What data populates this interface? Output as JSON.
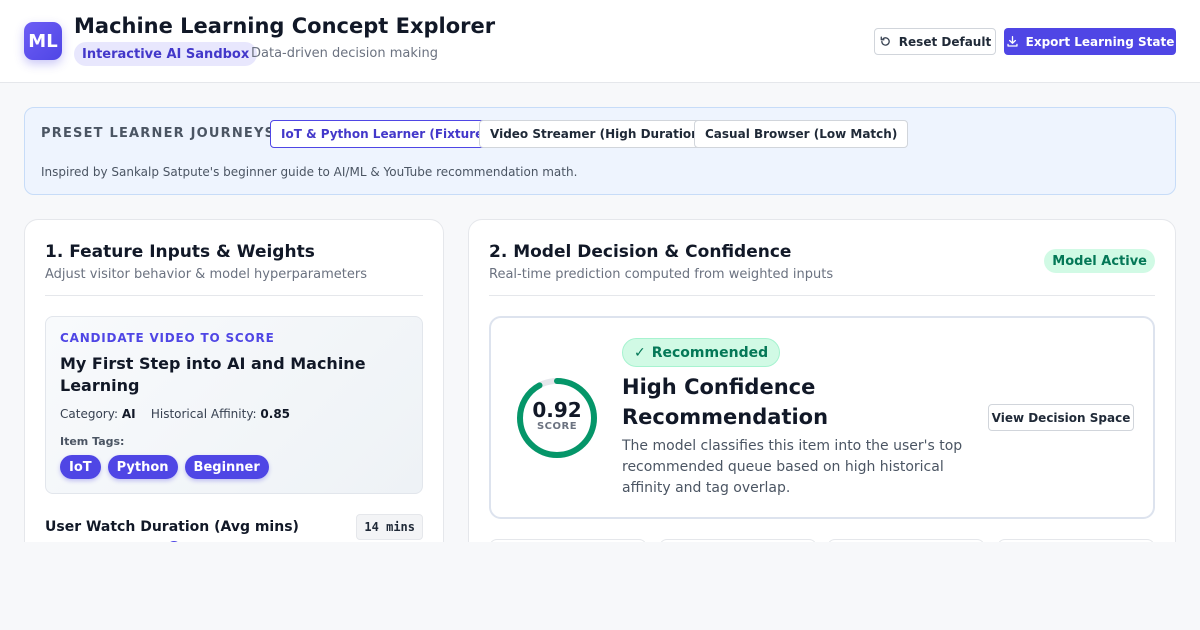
{
  "header": {
    "logo_text": "ML",
    "title": "Machine Learning Concept Explorer",
    "subtitle_badge": "Interactive AI Sandbox",
    "subtitle_caption": "Data-driven decision making",
    "reset_label": "Reset Default",
    "export_label": "Export Learning State",
    "reset_icon": "refresh-icon",
    "export_icon": "download-icon"
  },
  "presets": {
    "label": "PRESET LEARNER JOURNEYS:",
    "options": [
      {
        "label": "IoT & Python Learner (Fixture)",
        "active": true
      },
      {
        "label": "Video Streamer (High Duration)",
        "active": false
      },
      {
        "label": "Casual Browser (Low Match)",
        "active": false
      }
    ],
    "note": "Inspired by Sankalp Satpute's beginner guide to AI/ML & YouTube recommendation math."
  },
  "inputs": {
    "title": "1. Feature Inputs & Weights",
    "subtitle": "Adjust visitor behavior & model hyperparameters",
    "candidate": {
      "label": "CANDIDATE VIDEO TO SCORE",
      "title": "My First Step into AI and Machine Learning",
      "category_label": "Category:",
      "category_value": "AI",
      "affinity_label": "Historical Affinity:",
      "affinity_value": "0.85",
      "tags_label": "Item Tags:",
      "tags": [
        "IoT",
        "Python",
        "Beginner"
      ]
    },
    "duration_label": "User Watch Duration (Avg mins)",
    "duration_value": "14 mins"
  },
  "decision": {
    "title": "2. Model Decision & Confidence",
    "subtitle": "Real-time prediction computed from weighted inputs",
    "status_badge": "Model Active",
    "score": "0.92",
    "score_fraction": 0.92,
    "score_caption": "SCORE",
    "recommended_label": "Recommended",
    "recommended_icon": "check-icon",
    "headline": "High Confidence Recommendation",
    "description": "The model classifies this item into the user's top recommended queue based on high historical affinity and tag overlap.",
    "view_space_label": "View Decision Space"
  },
  "colors": {
    "accent": "#4f46e5",
    "success": "#059669",
    "success_bg": "#d1fae5"
  }
}
